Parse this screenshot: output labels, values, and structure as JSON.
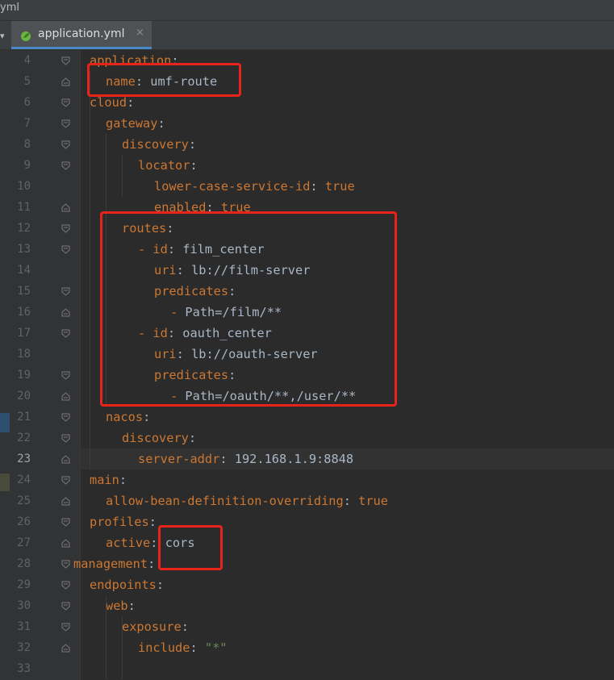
{
  "window": {
    "title_fragment": "yml"
  },
  "tab": {
    "label": "application.yml",
    "close_glyph": "×",
    "icon": "spring-leaf-icon",
    "arrow_glyph": "▾"
  },
  "lines": [
    {
      "num": "4",
      "key": "application",
      "sep": ":",
      "val": ""
    },
    {
      "num": "5",
      "key": "name",
      "sep": ": ",
      "val": "umf-route"
    },
    {
      "num": "6",
      "key": "cloud",
      "sep": ":",
      "val": ""
    },
    {
      "num": "7",
      "key": "gateway",
      "sep": ":",
      "val": ""
    },
    {
      "num": "8",
      "key": "discovery",
      "sep": ":",
      "val": ""
    },
    {
      "num": "9",
      "key": "locator",
      "sep": ":",
      "val": ""
    },
    {
      "num": "10",
      "key": "lower-case-service-id",
      "sep": ": ",
      "val": "true"
    },
    {
      "num": "11",
      "key": "enabled",
      "sep": ": ",
      "val": "true"
    },
    {
      "num": "12",
      "key": "routes",
      "sep": ":",
      "val": ""
    },
    {
      "num": "13",
      "dash": "- ",
      "key": "id",
      "sep": ": ",
      "val": "film_center"
    },
    {
      "num": "14",
      "key": "uri",
      "sep": ": ",
      "val": "lb://film-server"
    },
    {
      "num": "15",
      "key": "predicates",
      "sep": ":",
      "val": ""
    },
    {
      "num": "16",
      "dash": "- ",
      "key": "",
      "sep": "",
      "val": "Path=/film/**"
    },
    {
      "num": "17",
      "dash": "- ",
      "key": "id",
      "sep": ": ",
      "val": "oauth_center"
    },
    {
      "num": "18",
      "key": "uri",
      "sep": ": ",
      "val": "lb://oauth-server"
    },
    {
      "num": "19",
      "key": "predicates",
      "sep": ":",
      "val": ""
    },
    {
      "num": "20",
      "dash": "- ",
      "key": "",
      "sep": "",
      "val": "Path=/oauth/**,/user/**"
    },
    {
      "num": "21",
      "key": "nacos",
      "sep": ":",
      "val": ""
    },
    {
      "num": "22",
      "key": "discovery",
      "sep": ":",
      "val": ""
    },
    {
      "num": "23",
      "key": "server-addr",
      "sep": ": ",
      "val": "192.168.1.9:8848"
    },
    {
      "num": "24",
      "key": "main",
      "sep": ":",
      "val": ""
    },
    {
      "num": "25",
      "key": "allow-bean-definition-overriding",
      "sep": ": ",
      "val": "true"
    },
    {
      "num": "26",
      "key": "profiles",
      "sep": ":",
      "val": ""
    },
    {
      "num": "27",
      "key": "active",
      "sep": ": ",
      "val": "cors"
    },
    {
      "num": "28",
      "key": "management",
      "sep": ":",
      "val": ""
    },
    {
      "num": "29",
      "key": "endpoints",
      "sep": ":",
      "val": ""
    },
    {
      "num": "30",
      "key": "web",
      "sep": ":",
      "val": ""
    },
    {
      "num": "31",
      "key": "exposure",
      "sep": ":",
      "val": ""
    },
    {
      "num": "32",
      "key": "include",
      "sep": ": ",
      "val": "\"*\""
    },
    {
      "num": "33",
      "key": "",
      "sep": "",
      "val": ""
    }
  ],
  "current_line": "23",
  "colors": {
    "key": "#cc7832",
    "value": "#a9b7c6",
    "string": "#6a8759",
    "highlight_box": "#e8231c"
  }
}
